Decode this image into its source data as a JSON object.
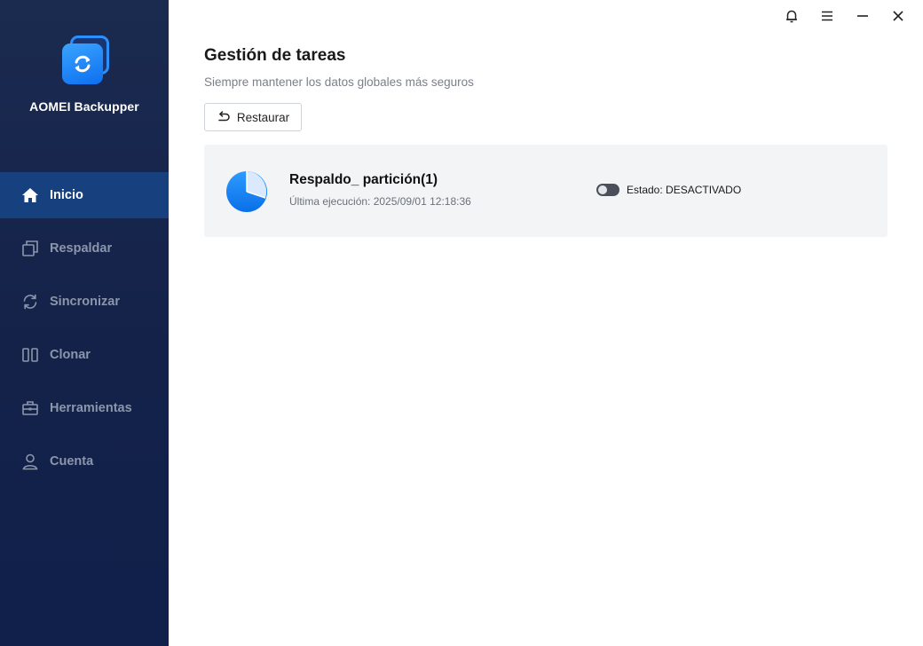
{
  "app": {
    "name": "AOMEI Backupper"
  },
  "sidebar": {
    "items": [
      {
        "label": "Inicio",
        "icon": "home-icon",
        "active": true
      },
      {
        "label": "Respaldar",
        "icon": "backup-icon",
        "active": false
      },
      {
        "label": "Sincronizar",
        "icon": "sync-icon",
        "active": false
      },
      {
        "label": "Clonar",
        "icon": "clone-icon",
        "active": false
      },
      {
        "label": "Herramientas",
        "icon": "toolbox-icon",
        "active": false
      },
      {
        "label": "Cuenta",
        "icon": "user-icon",
        "active": false
      }
    ]
  },
  "window_controls": [
    "bell-icon",
    "menu-icon",
    "minimize-icon",
    "close-icon"
  ],
  "main": {
    "title": "Gestión de tareas",
    "subtitle": "Siempre mantener los datos globales más seguros",
    "restore_label": "Restaurar",
    "task": {
      "name": "Respaldo_ partición(1)",
      "last_run": "Última ejecución: 2025/09/01 12:18:36",
      "status": "Estado: DESACTIVADO",
      "enabled": false
    }
  },
  "colors": {
    "sidebar_bg": "#14224a",
    "active_item": "#17407e",
    "accent": "#1a86ff",
    "card_bg": "#f3f4f6"
  }
}
